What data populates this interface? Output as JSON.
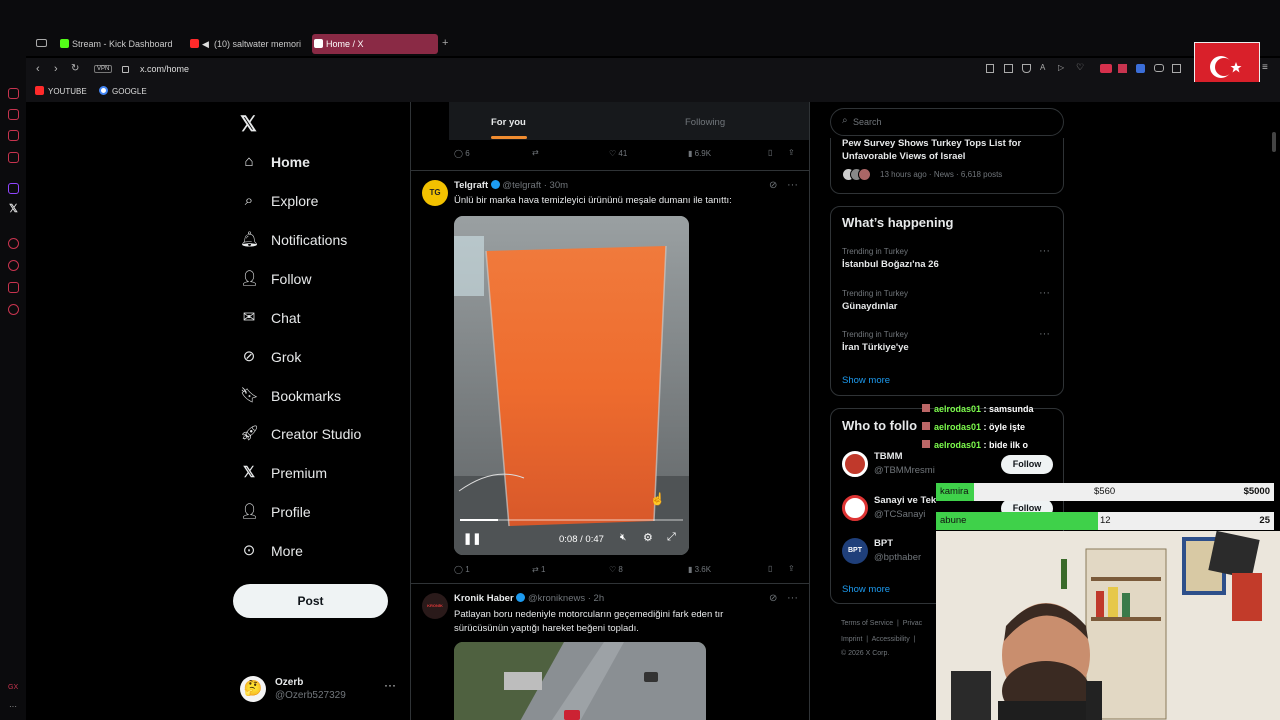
{
  "tabs": [
    {
      "label": "Stream - Kick Dashboard",
      "color": "#53fc18"
    },
    {
      "label": "(10) saltwater memori",
      "color": "#ff2a2a"
    },
    {
      "label": "Home / X",
      "color": "#ffffff"
    }
  ],
  "address": {
    "vpn": "VPN",
    "url": "x.com/home"
  },
  "bookmarks": [
    {
      "label": "YOUTUBE",
      "color": "#ff2a2a"
    },
    {
      "label": "GOOGLE",
      "color": "#4285f4"
    }
  ],
  "nav": {
    "items": [
      {
        "label": "Home",
        "icon": "home-icon"
      },
      {
        "label": "Explore",
        "icon": "search-icon"
      },
      {
        "label": "Notifications",
        "icon": "bell-icon"
      },
      {
        "label": "Follow",
        "icon": "person-add-icon"
      },
      {
        "label": "Chat",
        "icon": "mail-icon"
      },
      {
        "label": "Grok",
        "icon": "grok-icon"
      },
      {
        "label": "Bookmarks",
        "icon": "bookmark-icon"
      },
      {
        "label": "Creator Studio",
        "icon": "rocket-icon"
      },
      {
        "label": "Premium",
        "icon": "x-logo-icon"
      },
      {
        "label": "Profile",
        "icon": "person-icon"
      },
      {
        "label": "More",
        "icon": "more-circle-icon"
      }
    ],
    "post_label": "Post",
    "user": {
      "name": "Ozerb",
      "handle": "@Ozerb527329"
    }
  },
  "feed": {
    "tabs": {
      "for_you": "For you",
      "following": "Following"
    },
    "prev_metrics": {
      "replies": "6",
      "likes": "41",
      "views": "6.9K"
    },
    "post1": {
      "name": "Telgraft",
      "handle": "@telgraft",
      "time": "· 30m",
      "text": "Ünlü bir marka hava temizleyici ürününü meşale dumanı ile tanıttı:",
      "video_time": "0:08 / 0:47",
      "video_progress": 0.17,
      "replies": "1",
      "reposts": "1",
      "likes": "8",
      "views": "3.6K"
    },
    "post2": {
      "name": "Kronik Haber",
      "handle": "@kroniknews",
      "time": "· 2h",
      "text_line1": "Patlayan boru nedeniyle motorcuların geçemediğini fark eden tır",
      "text_line2": "sürücüsünün yaptığı hareket beğeni topladı.",
      "avatar_text": "KRONİK HABER"
    }
  },
  "right": {
    "search_placeholder": "Search",
    "news": {
      "title_line1": "Pew Survey Shows Turkey Tops List for",
      "title_line2": "Unfavorable Views of Israel",
      "meta": "13 hours ago · News · 6,618 posts"
    },
    "happening": {
      "title": "What’s happening",
      "trends": [
        {
          "context": "Trending in Turkey",
          "name": "İstanbul Boğazı'na 26"
        },
        {
          "context": "Trending in Turkey",
          "name": "Günaydınlar"
        },
        {
          "context": "Trending in Turkey",
          "name": "İran Türkiye'ye"
        }
      ],
      "show_more": "Show more"
    },
    "who": {
      "title": "Who to follo",
      "accounts": [
        {
          "name": "TBMM",
          "handle": "@TBMMresmi",
          "follow": "Follow"
        },
        {
          "name": "Sanayi ve Tek",
          "handle": "@TCSanayi",
          "follow": "Follow"
        },
        {
          "name": "BPT",
          "handle": "@bpthaber",
          "follow": ""
        }
      ],
      "show_more": "Show more"
    },
    "footer": {
      "line1a": "Terms of Service",
      "line1b": "Privac",
      "line2a": "Imprint",
      "line2b": "Accessibility",
      "copyright": "© 2026 X Corp."
    }
  },
  "overlay": {
    "chat": [
      {
        "user": "aelrodas01",
        "msg": " : samsunda"
      },
      {
        "user": "aelrodas01",
        "msg": " : öyle işte"
      },
      {
        "user": "aelrodas01",
        "msg": " : bide ilk o"
      }
    ],
    "goals": [
      {
        "label": "kamira",
        "current": "$560",
        "target": "$5000",
        "fraction": 0.112
      },
      {
        "label": "abune",
        "current": "12",
        "target": "25",
        "fraction": 0.48
      }
    ]
  },
  "colors": {
    "accent": "#1d9bf0",
    "tab_active": "#8a2a45",
    "goal_fill": "#3fd14a",
    "opera_red": "#c8344f"
  }
}
